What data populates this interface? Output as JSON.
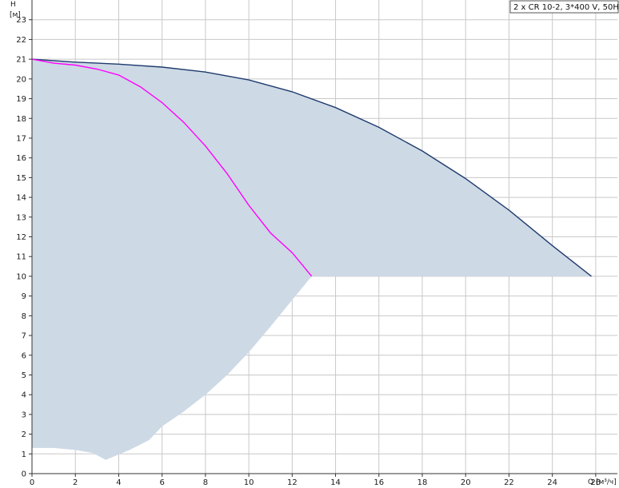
{
  "chart_data": {
    "type": "line",
    "title": "2 x CR 10-2, 3*400 V, 50Hz",
    "xlabel": "Q [м³/ч]",
    "ylabel": "H",
    "yunit": "[м]",
    "xlim": [
      0,
      27
    ],
    "ylim": [
      0,
      24
    ],
    "xticks": [
      0,
      2,
      4,
      6,
      8,
      10,
      12,
      14,
      16,
      18,
      20,
      22,
      24,
      26
    ],
    "yticks": [
      0,
      1,
      2,
      3,
      4,
      5,
      6,
      7,
      8,
      9,
      10,
      11,
      12,
      13,
      14,
      15,
      16,
      17,
      18,
      19,
      20,
      21,
      22,
      23
    ],
    "grid": true,
    "legend_position": "top-right",
    "colors": {
      "envelope_fill": "#cdd9e5",
      "parallel_curve": "#1f3b6e",
      "single_curve": "#ff00ff",
      "grid": "#c8c8c8",
      "axis": "#333333"
    },
    "series": [
      {
        "id": "parallel_curve",
        "x": [
          0,
          2,
          4,
          6,
          8,
          10,
          12,
          14,
          16,
          18,
          20,
          22,
          24,
          25.8
        ],
        "y": [
          21.0,
          20.85,
          20.75,
          20.6,
          20.35,
          19.95,
          19.35,
          18.55,
          17.55,
          16.35,
          14.95,
          13.35,
          11.55,
          10.0
        ]
      },
      {
        "id": "single_curve",
        "x": [
          0,
          1,
          2,
          3,
          4,
          5,
          6,
          7,
          8,
          9,
          10,
          11,
          12,
          12.9
        ],
        "y": [
          21.0,
          20.8,
          20.7,
          20.5,
          20.2,
          19.6,
          18.8,
          17.8,
          16.6,
          15.2,
          13.6,
          12.2,
          11.2,
          10.0
        ]
      }
    ],
    "envelope": {
      "upper": "parallel_curve",
      "lower_x": [
        25.8,
        12.9,
        12.0,
        11.0,
        10.0,
        9.0,
        8.0,
        7.0,
        6.0,
        5.4,
        4.5,
        3.4,
        2.8,
        2.0,
        1.0,
        0.0
      ],
      "lower_y": [
        10.0,
        10.0,
        8.8,
        7.45,
        6.15,
        5.0,
        4.0,
        3.15,
        2.4,
        1.7,
        1.2,
        0.7,
        1.05,
        1.2,
        1.3,
        1.3
      ]
    }
  }
}
